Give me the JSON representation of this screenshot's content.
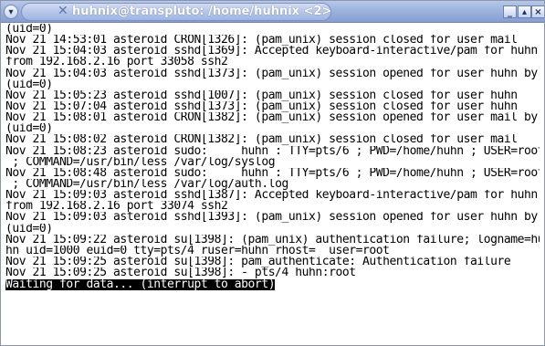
{
  "window": {
    "title": "huhnix@transpluto: /home/huhnix <2>",
    "menu_glyph": "▾",
    "app_icon": "x-icon",
    "buttons": {
      "minimize": "_",
      "maximize": "▴",
      "close": "×"
    }
  },
  "terminal": {
    "lines": [
      "(uid=0)",
      "Nov 21 14:53:01 asteroid CRON[1326]: (pam_unix) session closed for user mail",
      "Nov 21 15:04:03 asteroid sshd[1369]: Accepted keyboard-interactive/pam for huhn",
      "from 192.168.2.16 port 33058 ssh2",
      "Nov 21 15:04:03 asteroid sshd[1373]: (pam_unix) session opened for user huhn by",
      "(uid=0)",
      "Nov 21 15:05:23 asteroid sshd[1007]: (pam_unix) session closed for user huhn",
      "Nov 21 15:07:04 asteroid sshd[1373]: (pam_unix) session closed for user huhn",
      "Nov 21 15:08:01 asteroid CRON[1382]: (pam_unix) session opened for user mail by",
      "(uid=0)",
      "Nov 21 15:08:02 asteroid CRON[1382]: (pam_unix) session closed for user mail",
      "Nov 21 15:08:23 asteroid sudo:     huhn : TTY=pts/6 ; PWD=/home/huhn ; USER=root",
      " ; COMMAND=/usr/bin/less /var/log/syslog",
      "Nov 21 15:08:48 asteroid sudo:     huhn : TTY=pts/6 ; PWD=/home/huhn ; USER=root",
      " ; COMMAND=/usr/bin/less /var/log/auth.log",
      "Nov 21 15:09:03 asteroid sshd[1387]: Accepted keyboard-interactive/pam for huhn",
      "from 192.168.2.16 port 33074 ssh2",
      "Nov 21 15:09:03 asteroid sshd[1393]: (pam_unix) session opened for user huhn by",
      "(uid=0)",
      "Nov 21 15:09:22 asteroid su[1398]: (pam_unix) authentication failure; logname=hu",
      "hn uid=1000 euid=0 tty=pts/4 ruser=huhn rhost=  user=root",
      "Nov 21 15:09:25 asteroid su[1398]: pam_authenticate: Authentication failure",
      "Nov 21 15:09:25 asteroid su[1398]: - pts/4 huhn:root"
    ],
    "status_line": "Waiting for data... (interrupt to abort)"
  }
}
